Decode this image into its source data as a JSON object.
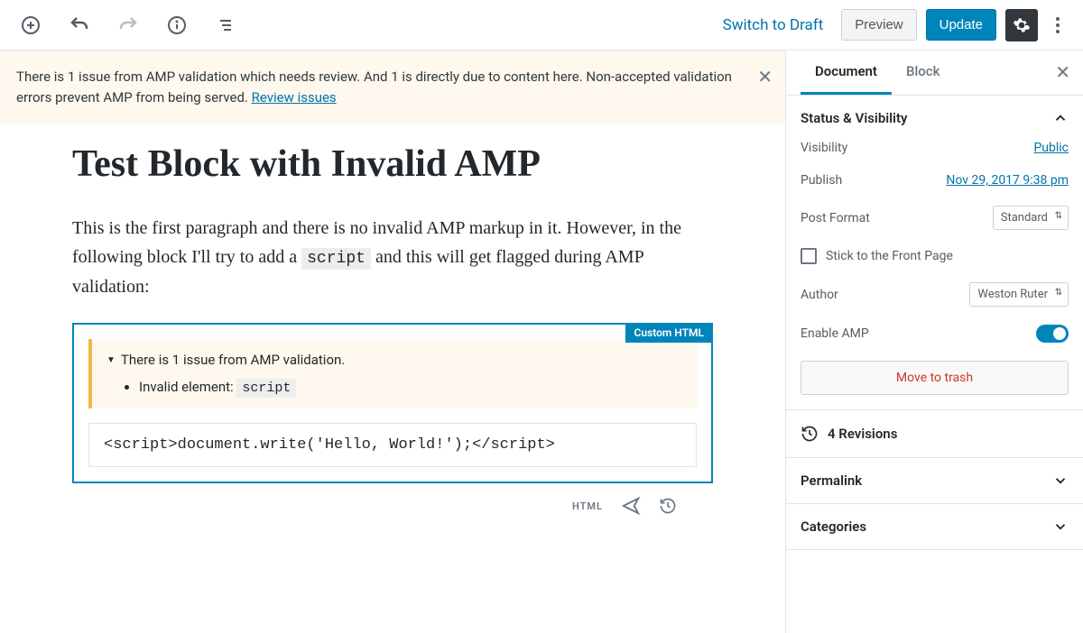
{
  "topbar": {
    "switch_draft": "Switch to Draft",
    "preview": "Preview",
    "update": "Update"
  },
  "notice": {
    "text_a": "There is 1 issue from AMP validation which needs review. And 1 is directly due to content here. Non-accepted validation errors prevent AMP from being served. ",
    "link": "Review issues"
  },
  "post": {
    "title": "Test Block with Invalid AMP",
    "para_a": "This is the first paragraph and there is no invalid AMP markup in it. However, in the following block I'll try to add a ",
    "para_code": "script",
    "para_b": " and this will get flagged during AMP validation:"
  },
  "block": {
    "label": "Custom HTML",
    "warn_summary": "There is 1 issue from AMP validation.",
    "warn_item_a": "Invalid element: ",
    "warn_item_code": "script",
    "code": "<script>document.write('Hello, World!');</script>"
  },
  "toolbar": {
    "html": "HTML"
  },
  "sidebar": {
    "tab_document": "Document",
    "tab_block": "Block",
    "status_title": "Status & Visibility",
    "visibility_label": "Visibility",
    "visibility_value": "Public",
    "publish_label": "Publish",
    "publish_value": "Nov 29, 2017 9:38 pm",
    "format_label": "Post Format",
    "format_value": "Standard",
    "stick_label": "Stick to the Front Page",
    "author_label": "Author",
    "author_value": "Weston Ruter",
    "amp_label": "Enable AMP",
    "trash": "Move to trash",
    "revisions": "4 Revisions",
    "permalink": "Permalink",
    "categories": "Categories"
  }
}
